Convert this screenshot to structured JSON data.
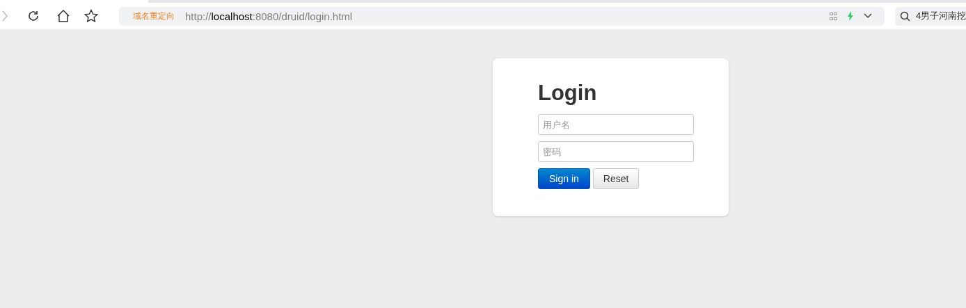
{
  "browser": {
    "redirect_label": "域名重定向",
    "url": "http://**localhost**:8080/druid/login.html",
    "search_text": "4男子河南挖"
  },
  "login": {
    "title": "Login",
    "fields": [
      {
        "placeholder": "用户名"
      },
      {
        "placeholder": "密码"
      }
    ],
    "buttons": [
      {
        "kind": "primary",
        "label": "Sign in"
      },
      {
        "kind": "default",
        "label": "Reset"
      }
    ]
  }
}
